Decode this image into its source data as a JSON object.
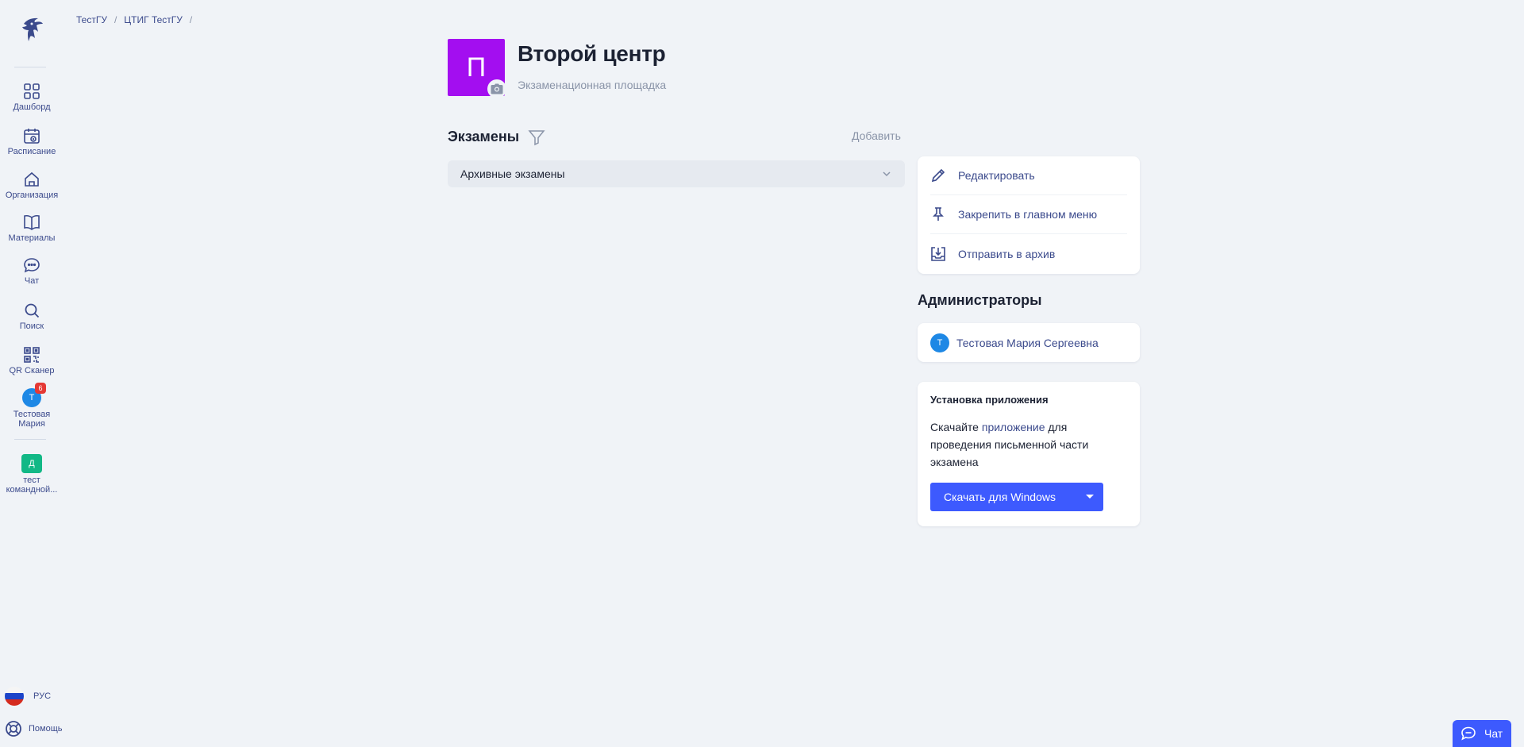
{
  "nav": {
    "items": [
      {
        "label": "Дашборд",
        "icon": "dashboard-icon"
      },
      {
        "label": "Расписание",
        "icon": "calendar-icon"
      },
      {
        "label": "Организация",
        "icon": "home-icon"
      },
      {
        "label": "Материалы",
        "icon": "book-icon"
      },
      {
        "label": "Чат",
        "icon": "chat-bubble-icon"
      },
      {
        "label": "Поиск",
        "icon": "search-icon"
      },
      {
        "label": "QR Сканер",
        "icon": "qr-icon"
      }
    ],
    "user": {
      "initial": "Т",
      "label_line1": "Тестовая",
      "label_line2": "Мария",
      "badge": "6"
    },
    "team": {
      "initial": "Д",
      "label_line1": "тест",
      "label_line2": "командной..."
    },
    "language": "РУС",
    "help": "Помощь"
  },
  "breadcrumb": [
    "ТестГУ",
    "ЦТИГ ТестГУ"
  ],
  "center": {
    "avatar_letter": "П",
    "title": "Второй центр",
    "subtitle": "Экзаменационная площадка"
  },
  "exams": {
    "title": "Экзамены",
    "add_label": "Добавить",
    "archive_label": "Архивные экзамены"
  },
  "actions": [
    {
      "label": "Редактировать",
      "icon": "pencil-icon"
    },
    {
      "label": "Закрепить в главном меню",
      "icon": "pin-icon"
    },
    {
      "label": "Отправить в архив",
      "icon": "archive-icon"
    }
  ],
  "admins": {
    "title": "Администраторы",
    "list": [
      {
        "initial": "Т",
        "name": "Тестовая Мария Сергеевна"
      }
    ]
  },
  "install": {
    "title": "Установка приложения",
    "text_before": "Скачайте ",
    "link": "приложение",
    "text_after": " для проведения письменной части экзамена",
    "button": "Скачать для Windows"
  },
  "chat_button": "Чат",
  "colors": {
    "accent": "#3d5afe",
    "nav_text": "#3b4a8c",
    "center_avatar": "#a30ef0",
    "badge": "#e53935",
    "team_avatar": "#12b886"
  }
}
